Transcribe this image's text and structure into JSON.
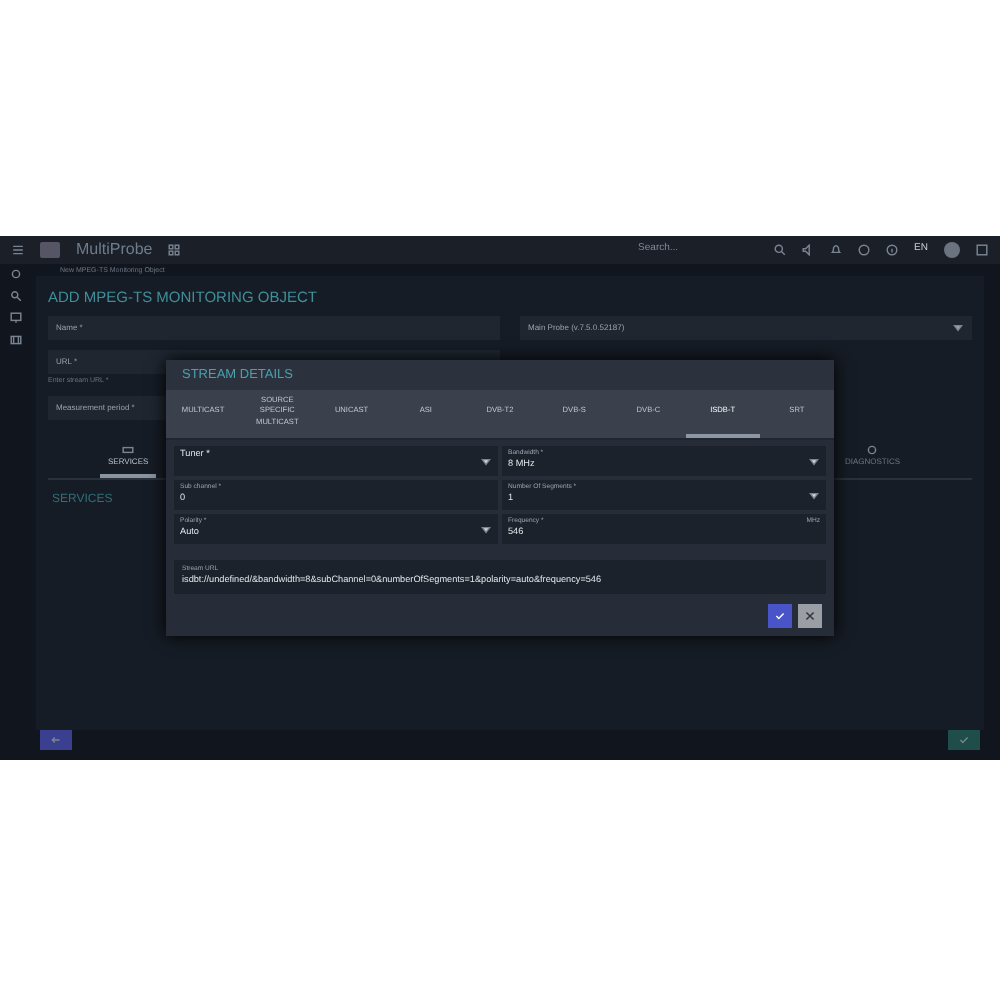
{
  "top_bar": {
    "logo": "MultiProbe",
    "search": {
      "placeholder": "Search..."
    },
    "language": "EN"
  },
  "breadcrumb": [
    "New MPEG-TS Monitoring Object"
  ],
  "page": {
    "title": "ADD MPEG-TS MONITORING OBJECT"
  },
  "form_rows": [
    [
      {
        "label": "Name *",
        "kind": "text"
      },
      {
        "label": "Main Probe (v.7.5.0.52187)",
        "kind": "select"
      }
    ],
    [
      {
        "label": "URL *",
        "kind": "text",
        "hint": "Enter stream URL *"
      }
    ],
    [
      {
        "label": "Measurement period *",
        "kind": "text"
      }
    ]
  ],
  "section_tabs": [
    {
      "label": "SERVICES",
      "selected": true
    },
    {
      "label": "DIAGNOSTICS",
      "selected": false
    }
  ],
  "section_title": "SERVICES",
  "dialog": {
    "title": "STREAM DETAILS",
    "tabs": [
      {
        "label": "MULTICAST",
        "selected": false
      },
      {
        "label": "SOURCE SPECIFIC MULTICAST",
        "selected": false
      },
      {
        "label": "UNICAST",
        "selected": false
      },
      {
        "label": "ASI",
        "selected": false
      },
      {
        "label": "DVB-T2",
        "selected": false
      },
      {
        "label": "DVB-S",
        "selected": false
      },
      {
        "label": "DVB-C",
        "selected": false
      },
      {
        "label": "ISDB-T",
        "selected": true
      },
      {
        "label": "SRT",
        "selected": false
      }
    ],
    "fields": [
      {
        "label": "Tuner *",
        "kind": "select"
      },
      {
        "label": "Bandwidth *",
        "value": "8 MHz",
        "kind": "select"
      },
      {
        "label": "Sub channel *",
        "value": "0",
        "kind": "text"
      },
      {
        "label": "Number Of Segments *",
        "value": "1",
        "kind": "select"
      },
      {
        "label": "Polarity *",
        "value": "Auto",
        "kind": "select"
      },
      {
        "label": "Frequency *",
        "value": "546",
        "unit": "MHz",
        "kind": "text"
      }
    ],
    "stream_url": {
      "label": "Stream URL",
      "value": "isdbt://undefined/&bandwidth=8&subChannel=0&numberOfSegments=1&polarity=auto&frequency=546"
    }
  }
}
